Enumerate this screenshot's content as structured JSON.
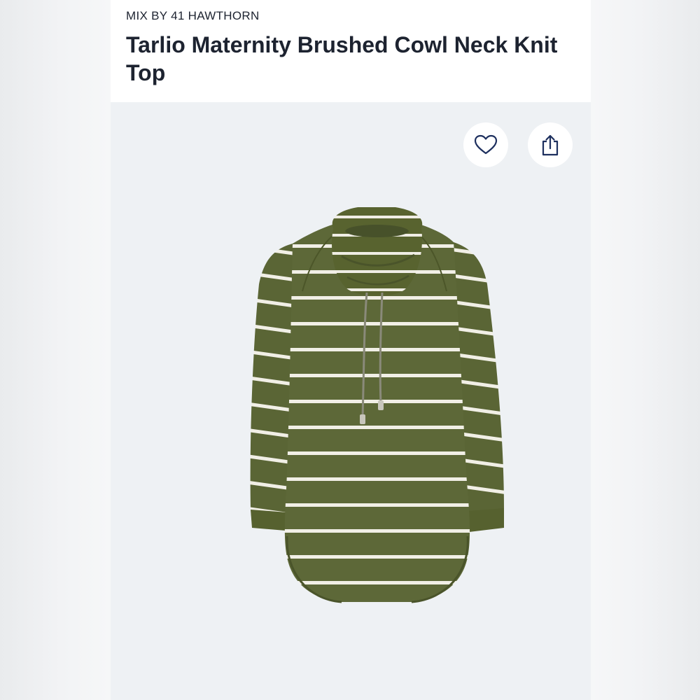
{
  "product": {
    "brand": "MIX BY 41 HAWTHORN",
    "title": "Tarlio Maternity Brushed Cowl Neck Knit Top"
  },
  "actions": {
    "favorite_icon": "heart-outline-icon",
    "share_icon": "share-upload-icon"
  },
  "colors": {
    "text": "#1d2330",
    "garment_olive": "#5d6838",
    "stripe": "#f1efe6",
    "background": "#eef1f4"
  }
}
